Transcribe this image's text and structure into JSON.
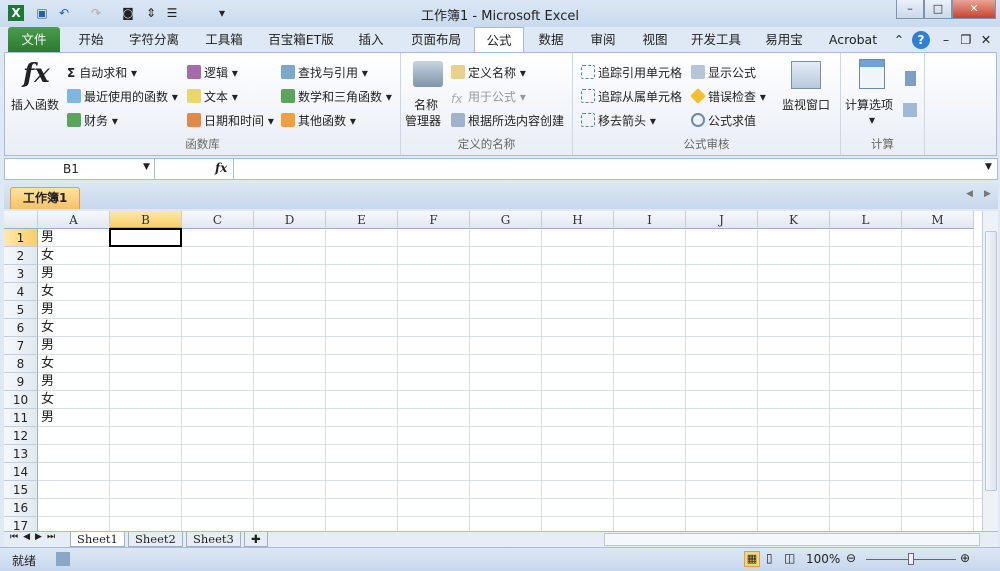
{
  "title": "工作簿1 - Microsoft Excel",
  "tabs": [
    "文件",
    "开始",
    "字符分离",
    "工具箱",
    "百宝箱ET版",
    "插入",
    "页面布局",
    "公式",
    "数据",
    "审阅",
    "视图",
    "开发工具",
    "易用宝",
    "Acrobat"
  ],
  "active_tab": "公式",
  "ribbon": {
    "function_library": {
      "label": "函数库",
      "insert_function": "插入函数",
      "items": [
        "自动求和",
        "最近使用的函数",
        "财务",
        "逻辑",
        "文本",
        "日期和时间",
        "查找与引用",
        "数学和三角函数",
        "其他函数"
      ]
    },
    "defined_names": {
      "label": "定义的名称",
      "name_manager_1": "名称",
      "name_manager_2": "管理器",
      "items": [
        "定义名称",
        "用于公式",
        "根据所选内容创建"
      ]
    },
    "formula_auditing": {
      "label": "公式审核",
      "items": [
        "追踪引用单元格",
        "追踪从属单元格",
        "移去箭头",
        "显示公式",
        "错误检查",
        "公式求值"
      ],
      "watch": "监视窗口"
    },
    "calculation": {
      "label": "计算",
      "options": "计算选项"
    }
  },
  "formula_bar": {
    "name_box": "B1",
    "fx": "fx",
    "value": ""
  },
  "workbook_tab": "工作簿1",
  "columns": [
    "A",
    "B",
    "C",
    "D",
    "E",
    "F",
    "G",
    "H",
    "I",
    "J",
    "K",
    "L",
    "M"
  ],
  "rows": [
    "1",
    "2",
    "3",
    "4",
    "5",
    "6",
    "7",
    "8",
    "9",
    "10",
    "11",
    "12",
    "13",
    "14",
    "15",
    "16",
    "17"
  ],
  "column_a_values": [
    "男",
    "女",
    "男",
    "女",
    "男",
    "女",
    "男",
    "女",
    "男",
    "女",
    "男"
  ],
  "sheets": [
    "Sheet1",
    "Sheet2",
    "Sheet3"
  ],
  "status": {
    "ready": "就绪",
    "zoom": "100%"
  }
}
